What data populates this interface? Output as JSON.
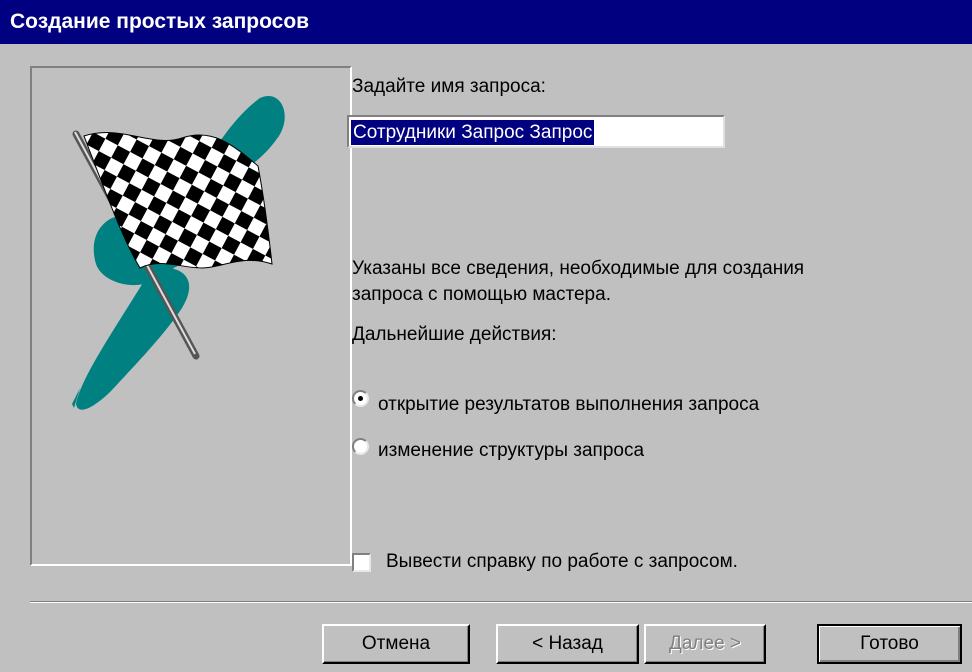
{
  "window": {
    "title": "Создание простых запросов"
  },
  "prompt_name_label": "Задайте имя запроса:",
  "query_name_value": "Сотрудники Запрос Запрос",
  "info_line1": "Указаны все сведения, необходимые для создания",
  "info_line2": "запроса с помощью мастера.",
  "next_steps_label": "Дальнейшие действия:",
  "options": [
    {
      "label": "открытие результатов выполнения запроса",
      "selected": true
    },
    {
      "label": "изменение структуры запроса",
      "selected": false
    }
  ],
  "help_checkbox": {
    "label": "Вывести справку по работе с запросом.",
    "checked": false
  },
  "buttons": {
    "cancel": "Отмена",
    "back": "< Назад",
    "next": "Далее >",
    "finish": "Готово"
  },
  "colors": {
    "title_bar": "#000080",
    "flag_swoosh": "#008080",
    "dialog_bg": "#c0c0c0"
  },
  "icons": {
    "illustration": "checkered-flag"
  }
}
